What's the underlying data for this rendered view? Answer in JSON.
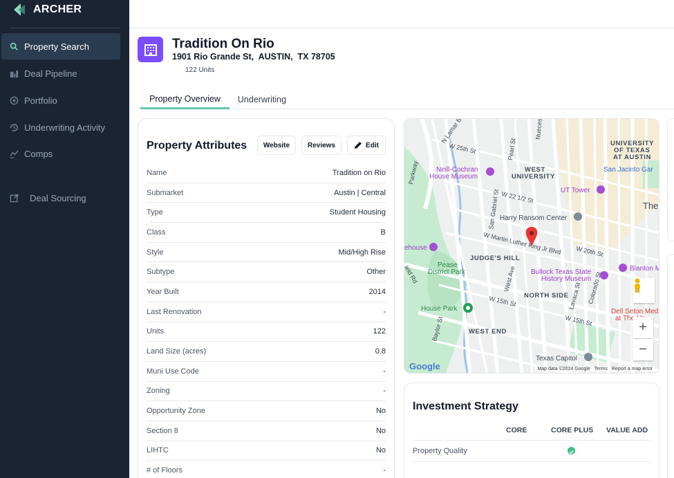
{
  "app": {
    "name": "ARCHER"
  },
  "sidebar": {
    "items": [
      {
        "label": "Property Search",
        "icon": "search-icon",
        "active": true
      },
      {
        "label": "Deal Pipeline",
        "icon": "building-chart-icon",
        "active": false
      },
      {
        "label": "Portfolio",
        "icon": "target-icon",
        "active": false
      },
      {
        "label": "Underwriting Activity",
        "icon": "history-icon",
        "active": false
      },
      {
        "label": "Comps",
        "icon": "compare-icon",
        "active": false
      }
    ],
    "sourcing": {
      "label": "Deal Sourcing",
      "icon": "external-link-icon"
    }
  },
  "property": {
    "name": "Tradition On Rio",
    "address": "1901 Rio Grande St,  AUSTIN,  TX 78705",
    "units": "122 Units"
  },
  "tabs": [
    {
      "label": "Property Overview",
      "active": true
    },
    {
      "label": "Underwriting",
      "active": false
    }
  ],
  "attributes": {
    "title": "Property Attributes",
    "website_label": "Website",
    "reviews_label": "Reviews",
    "edit_label": "Edit",
    "rows": [
      {
        "label": "Name",
        "value": "Tradition on Rio"
      },
      {
        "label": "Submarket",
        "value": "Austin | Central"
      },
      {
        "label": "Type",
        "value": "Student Housing"
      },
      {
        "label": "Class",
        "value": "B"
      },
      {
        "label": "Style",
        "value": "Mid/High Rise"
      },
      {
        "label": "Subtype",
        "value": "Other"
      },
      {
        "label": "Year Built",
        "value": "2014"
      },
      {
        "label": "Last Renovation",
        "value": "-"
      },
      {
        "label": "Units",
        "value": "122"
      },
      {
        "label": "Land Size (acres)",
        "value": "0.8"
      },
      {
        "label": "Muni Use Code",
        "value": "-"
      },
      {
        "label": "Zoning",
        "value": "-"
      },
      {
        "label": "Opportunity Zone",
        "value": "No"
      },
      {
        "label": "Section 8",
        "value": "No"
      },
      {
        "label": "LIHTC",
        "value": "No"
      },
      {
        "label": "# of Floors",
        "value": "-"
      }
    ]
  },
  "map": {
    "labels": {
      "university": "UNIVERSITY",
      "of_texas": "OF TEXAS",
      "at_austin": "AT AUSTIN",
      "west_univ_1": "WEST",
      "west_univ_2": "UNIVERSITY",
      "neill1": "Neill-Cochran",
      "neill2": "House Museum",
      "san_jacinto": "San Jacinto Gar",
      "ut_tower": "UT Tower",
      "harry": "Harry Ransom Center",
      "judges": "JUDGE'S HILL",
      "pease1": "Pease",
      "pease2": "District Park",
      "bullock1": "Bullock Texas State",
      "bullock2": "History Museum",
      "blanton": "Blanton M",
      "north_side": "NORTH SIDE",
      "house_park": "House Park",
      "dell1": "Dell Seton Med",
      "dell2": "at The Un",
      "west_end": "WEST END",
      "capitol": "Texas Capitol",
      "the": "The",
      "ehouse": "ehouse",
      "mlk": "W Martin Luther King Jr Blvd",
      "w15": "W 15th St",
      "w15b": "W 15th St",
      "w20": "W 20th St",
      "w25": "W 25th St",
      "w222": "W 22 1/2 St",
      "lamar": "N Lamar Blvd",
      "lavaca": "Lavaca St",
      "colorado": "Colorado St",
      "west_ave": "West Ave",
      "baylor": "Baylor St",
      "san_gabriel": "San Gabriel St",
      "pearl": "Pearl St",
      "nueces": "Nueces St",
      "parkway": "Parkway",
      "field_rd": "ield Rd",
      "w_sixteenth": "W 16th St"
    },
    "footer": {
      "data": "Map data ©2024 Google",
      "terms": "Terms",
      "report": "Report a map error"
    },
    "google": "Google",
    "zoom_in": "+",
    "zoom_out": "−",
    "colors": {
      "park": "#c6ebd0",
      "road": "#ffffff",
      "campus": "#f4ecd6",
      "poi": "#a64ed6",
      "pin": "#e53935"
    }
  },
  "investment": {
    "title": "Investment Strategy",
    "columns": [
      "CORE",
      "CORE PLUS",
      "VALUE ADD"
    ],
    "rows": [
      {
        "label": "Property Quality",
        "checked_column": "CORE PLUS"
      }
    ]
  },
  "colors": {
    "sidebar": "#1b2433",
    "accent": "#7c4dff",
    "tab_underline": "#66c9a6",
    "check": "#3fbf8a"
  }
}
